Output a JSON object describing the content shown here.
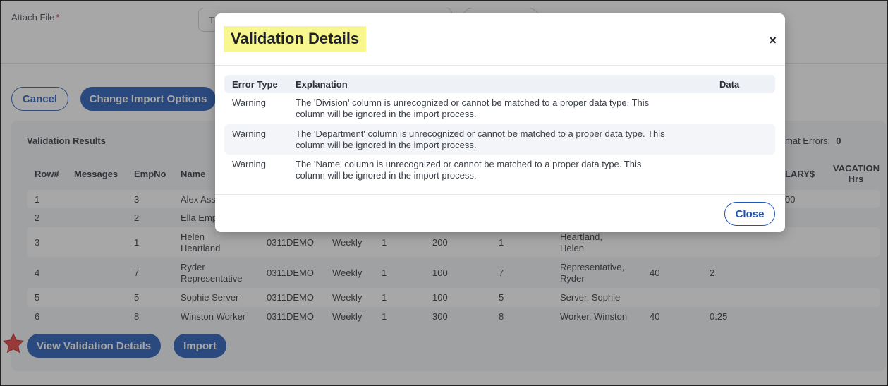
{
  "form": {
    "attach_label": "Attach File",
    "required_mark": "*",
    "attach_placeholder": "T"
  },
  "actions": {
    "cancel": "Cancel",
    "change_import_options": "Change Import Options",
    "view_validation_details": "View Validation Details",
    "import": "Import"
  },
  "results": {
    "title": "Validation Results",
    "format_errors_label": "mat Errors:",
    "format_errors_value": "0",
    "headers": [
      "Row#",
      "Messages",
      "EmpNo",
      "Name",
      "LARY$",
      "VACATION",
      "Hrs"
    ],
    "rows": [
      {
        "row": "1",
        "empno": "3",
        "name": "Alex Ass",
        "salary": "00"
      },
      {
        "row": "2",
        "empno": "2",
        "name": "Ella Emp"
      },
      {
        "row": "3",
        "empno": "1",
        "name1": "Helen",
        "name2": "Heartland",
        "code": "0311DEMO",
        "freq": "Weekly",
        "a": "1",
        "b": "200",
        "c": "1",
        "full1": "Heartland,",
        "full2": "Helen"
      },
      {
        "row": "4",
        "empno": "7",
        "name1": "Ryder",
        "name2": "Representative",
        "code": "0311DEMO",
        "freq": "Weekly",
        "a": "1",
        "b": "100",
        "c": "7",
        "full1": "Representative,",
        "full2": "Ryder",
        "d": "40",
        "e": "2"
      },
      {
        "row": "5",
        "empno": "5",
        "name": "Sophie Server",
        "code": "0311DEMO",
        "freq": "Weekly",
        "a": "1",
        "b": "100",
        "c": "5",
        "full": "Server, Sophie"
      },
      {
        "row": "6",
        "empno": "8",
        "name": "Winston Worker",
        "code": "0311DEMO",
        "freq": "Weekly",
        "a": "1",
        "b": "300",
        "c": "8",
        "full": "Worker, Winston",
        "d": "40",
        "e": "0.25"
      }
    ]
  },
  "modal": {
    "title": "Validation Details",
    "close_icon": "×",
    "close_label": "Close",
    "headers": {
      "type": "Error Type",
      "explanation": "Explanation",
      "data": "Data"
    },
    "rows": [
      {
        "type": "Warning",
        "line1": "The 'Division' column is unrecognized or cannot be matched to a proper data type. This",
        "line2": "column will be ignored in the import process."
      },
      {
        "type": "Warning",
        "line1": "The 'Department' column is unrecognized or cannot be matched to a proper data type. This",
        "line2": "column will be ignored in the import process."
      },
      {
        "type": "Warning",
        "line1": "The 'Name' column is unrecognized or cannot be matched to a proper data type. This",
        "line2": "column will be ignored in the import process."
      }
    ]
  },
  "icons": {
    "star": "star-icon",
    "star_color": "#e53935"
  }
}
